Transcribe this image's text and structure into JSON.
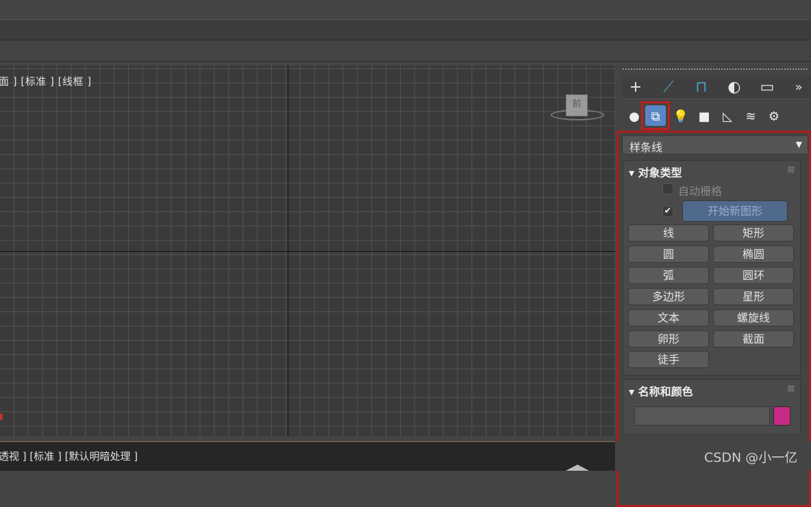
{
  "viewport": {
    "label": "面 ] [标准 ] [线框 ]",
    "viewcube_face": "前"
  },
  "status_bar": {
    "label": "透视 ] [标准 ] [默认明暗处理 ]"
  },
  "command_panel": {
    "tabs_row1": [
      {
        "name": "create-icon",
        "glyph": "+"
      },
      {
        "name": "modify-icon",
        "glyph": "⟋"
      },
      {
        "name": "hierarchy-icon",
        "glyph": "⊓"
      },
      {
        "name": "motion-icon",
        "glyph": "◐"
      },
      {
        "name": "display-icon",
        "glyph": "▭"
      },
      {
        "name": "more-icon",
        "glyph": "»"
      }
    ],
    "tabs_row2": [
      {
        "name": "geometry-icon",
        "glyph": "●"
      },
      {
        "name": "shapes-icon",
        "glyph": "⧉"
      },
      {
        "name": "lights-icon",
        "glyph": "💡"
      },
      {
        "name": "cameras-icon",
        "glyph": "■"
      },
      {
        "name": "helpers-icon",
        "glyph": "◺"
      },
      {
        "name": "spacewarps-icon",
        "glyph": "≋"
      },
      {
        "name": "systems-icon",
        "glyph": "⚙"
      }
    ],
    "dropdown_value": "样条线",
    "object_type": {
      "header": "对象类型",
      "auto_grid": "自动栅格",
      "start_new_shape": "开始新图形",
      "start_new_shape_checked": true,
      "buttons": [
        "线",
        "矩形",
        "圆",
        "椭圆",
        "弧",
        "圆环",
        "多边形",
        "星形",
        "文本",
        "螺旋线",
        "卵形",
        "截面",
        "徒手"
      ]
    },
    "name_and_color": {
      "header": "名称和颜色",
      "name_value": "",
      "color": "#c72a84"
    }
  },
  "watermark": "CSDN @小一亿"
}
